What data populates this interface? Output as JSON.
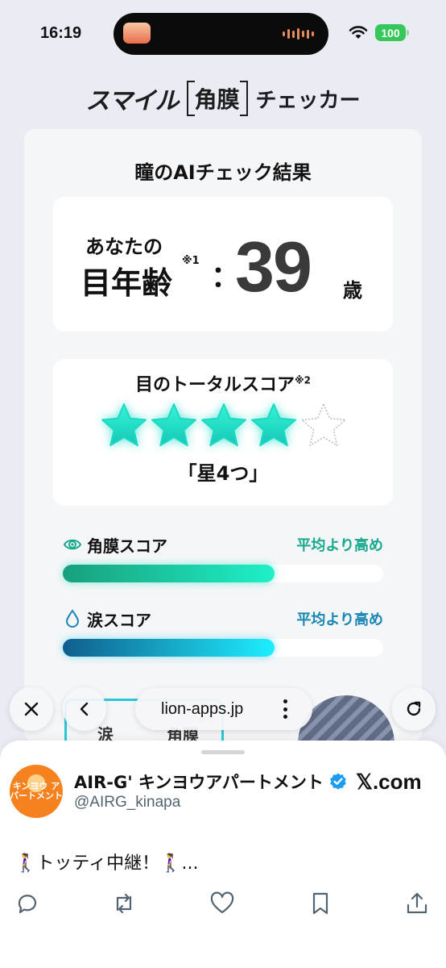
{
  "status": {
    "time": "16:19",
    "battery": "100"
  },
  "logo": {
    "left": "スマイル",
    "boxed": "角膜",
    "right": "チェッカー"
  },
  "result": {
    "title": "瞳のAIチェック結果",
    "age_prefix": "あなたの",
    "age_label": "目年齢",
    "age_note": "※1",
    "age_colon": "：",
    "age_value": "39",
    "age_unit": "歳",
    "score_title": "目のトータルスコア",
    "score_note": "※2",
    "stars_total": 5,
    "stars_filled": 4,
    "score_result": "「星4つ」"
  },
  "meters": [
    {
      "name": "角膜スコア",
      "badge": "平均より高め",
      "icon": "eye-icon",
      "level_percent": 66
    },
    {
      "name": "涙スコア",
      "badge": "平均より高め",
      "icon": "drop-icon",
      "level_percent": 66
    }
  ],
  "peek": {
    "left": "涙",
    "right": "角膜"
  },
  "browser": {
    "url": "lion-apps.jp",
    "close_icon": "close-icon",
    "back_icon": "chevron-left-icon",
    "reload_icon": "reload-icon"
  },
  "post": {
    "avatar_text": "キンヨウ アパートメント",
    "account_name": "AIR-G' キンヨウアパートメント",
    "handle": "@AIRG_kinapa",
    "site": "𝕏.com",
    "text": "🚶‍♀️トッティ中継！🚶‍♀️..."
  },
  "colors": {
    "accent_teal": "#1ef0c8",
    "accent_blue": "#1a86b5",
    "verified": "#1d9bf0"
  }
}
